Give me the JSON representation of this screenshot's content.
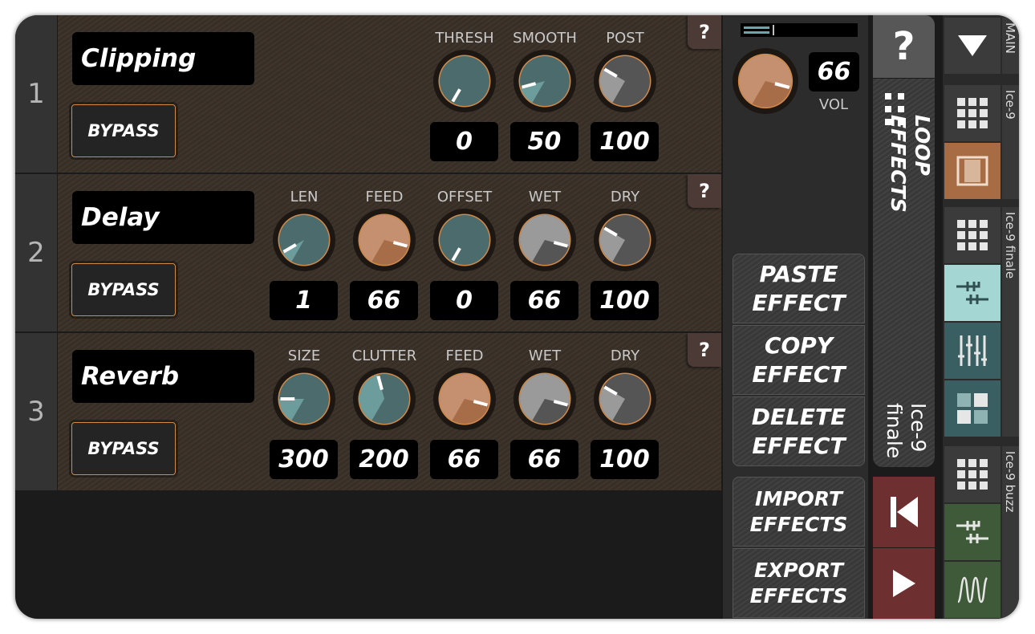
{
  "effects": [
    {
      "number": "1",
      "name": "Clipping",
      "bypass_label": "BYPASS",
      "help_label": "?",
      "params": [
        {
          "label": "THRESH",
          "value": "0",
          "level": 0.0
        },
        {
          "label": "SMOOTH",
          "value": "50",
          "level": 0.15
        },
        {
          "label": "POST",
          "value": "100",
          "level": 0.3
        }
      ]
    },
    {
      "number": "2",
      "name": "Delay",
      "bypass_label": "BYPASS",
      "help_label": "?",
      "params": [
        {
          "label": "LEN",
          "value": "1",
          "level": 0.1
        },
        {
          "label": "FEED",
          "value": "66",
          "level": 0.85
        },
        {
          "label": "OFFSET",
          "value": "0",
          "level": 0.0
        },
        {
          "label": "WET",
          "value": "66",
          "level": 0.85
        },
        {
          "label": "DRY",
          "value": "100",
          "level": 0.3
        }
      ]
    },
    {
      "number": "3",
      "name": "Reverb",
      "bypass_label": "BYPASS",
      "help_label": "?",
      "params": [
        {
          "label": "SIZE",
          "value": "300",
          "level": 0.2
        },
        {
          "label": "CLUTTER",
          "value": "200",
          "level": 0.45
        },
        {
          "label": "FEED",
          "value": "66",
          "level": 0.85
        },
        {
          "label": "WET",
          "value": "66",
          "level": 0.85
        },
        {
          "label": "DRY",
          "value": "100",
          "level": 0.3
        }
      ]
    }
  ],
  "volume": {
    "value": "66",
    "label": "VOL",
    "level": 0.85,
    "meter_level": 0.25
  },
  "actions": {
    "paste": "PASTE\nEFFECT",
    "copy": "COPY\nEFFECT",
    "delete": "DELETE\nEFFECT",
    "import": "IMPORT\nEFFECTS",
    "export": "EXPORT\nEFFECTS"
  },
  "loop": {
    "help_label": "?",
    "title": "LOOP\nEFFECTS",
    "current": "Ice-9\nfinale"
  },
  "transport": {
    "rewind_icon": "skip-back-icon",
    "play_icon": "play-icon"
  },
  "side_labels": {
    "main": "MAIN",
    "ice9": "Ice-9",
    "ice9_finale": "Ice-9 finale",
    "ice9_buzz": "Ice-9 buzz"
  },
  "side_tiles": [
    {
      "icon": "dropdown-triangle-icon",
      "color": "#3b3b3b"
    },
    {
      "icon": "grid-icon",
      "color": "#3b3b3b"
    },
    {
      "icon": "loop-bracket-icon",
      "color": "#a86c45"
    },
    {
      "icon": "grid-icon",
      "color": "#3b3b3b"
    },
    {
      "icon": "effects-chain-icon",
      "color": "#a4d6d4"
    },
    {
      "icon": "mixer-sliders-icon",
      "color": "#3a5f62"
    },
    {
      "icon": "pad-blocks-icon",
      "color": "#3a5f62"
    },
    {
      "icon": "grid-icon",
      "color": "#3b3b3b"
    },
    {
      "icon": "effects-chain-icon",
      "color": "#3f5a39"
    },
    {
      "icon": "waveform-icon",
      "color": "#3f5a39"
    }
  ],
  "colors": {
    "teal_knob": "#4b6b6c",
    "teal_light": "#6d9c9c",
    "orange_knob": "#a76c48",
    "orange_light": "#c49070",
    "gray_knob": "#555555",
    "gray_light": "#9a9a9a",
    "accent_orange": "#d08a4a",
    "transport_red": "#6d2f2f"
  }
}
